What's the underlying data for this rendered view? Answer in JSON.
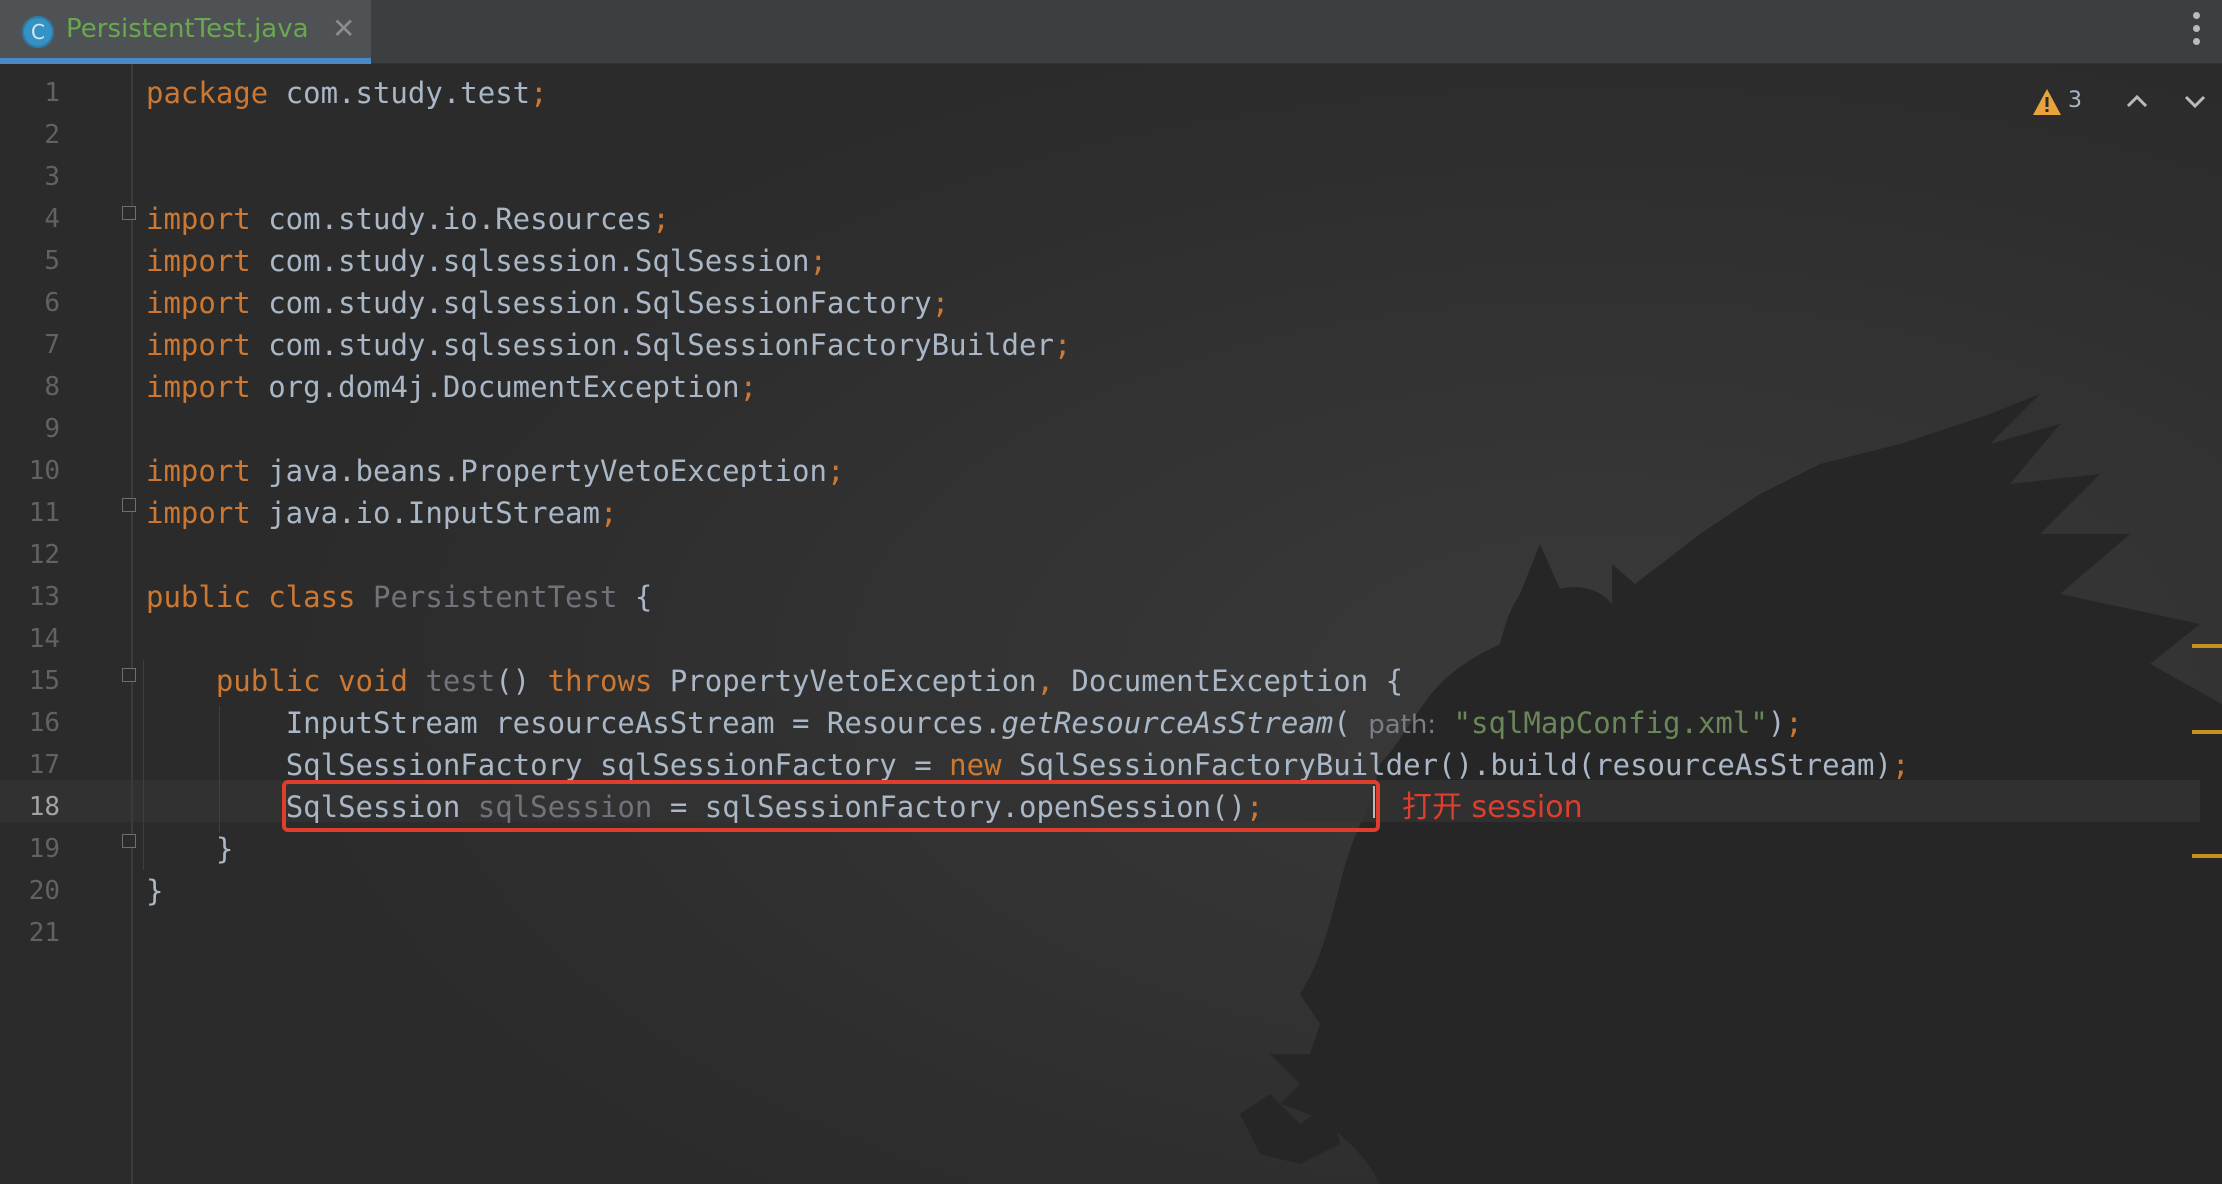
{
  "tab": {
    "icon_letter": "C",
    "title": "PersistentTest.java",
    "close_glyph": "✕"
  },
  "inspection": {
    "warning_count": "3"
  },
  "editor": {
    "current_line": 18,
    "line_numbers": [
      "1",
      "2",
      "3",
      "4",
      "5",
      "6",
      "7",
      "8",
      "9",
      "10",
      "11",
      "12",
      "13",
      "14",
      "15",
      "16",
      "17",
      "18",
      "19",
      "20",
      "21"
    ]
  },
  "code": {
    "l1_kw": "package",
    "l1_rest": " com.study.test",
    "semi": ";",
    "import_kw": "import",
    "l4": " com.study.io.Resources",
    "l5": " com.study.sqlsession.SqlSession",
    "l6": " com.study.sqlsession.SqlSessionFactory",
    "l7": " com.study.sqlsession.SqlSessionFactoryBuilder",
    "l8": " org.dom4j.DocumentException",
    "l10": " java.beans.PropertyVetoException",
    "l11": " java.io.InputStream",
    "l13_kw": "public class",
    "l13_name": "PersistentTest",
    "l13_brace": " {",
    "l15_kw": "public void",
    "l15_name": "test",
    "l15_parens": "()",
    "l15_throws": "throws",
    "l15_ex1": " PropertyVetoException",
    "comma": ",",
    "l15_ex2": " DocumentException {",
    "l16_a": "InputStream resourceAsStream = Resources.",
    "l16_method": "getResourceAsStream",
    "l16_paren": "( ",
    "l16_hint": "path:",
    "l16_str": "\"sqlMapConfig.xml\"",
    "l16_close": ")",
    "l17_a": "SqlSessionFactory sqlSessionFactory = ",
    "l17_new": "new",
    "l17_b": " SqlSessionFactoryBuilder().build(resourceAsStream)",
    "l18_type": "SqlSession ",
    "l18_var": "sqlSession",
    "l18_rest": " = sqlSessionFactory.openSession()",
    "l19": "}",
    "l20": "}"
  },
  "annotation": {
    "text": "打开 session",
    "color": "#e03e2d"
  }
}
